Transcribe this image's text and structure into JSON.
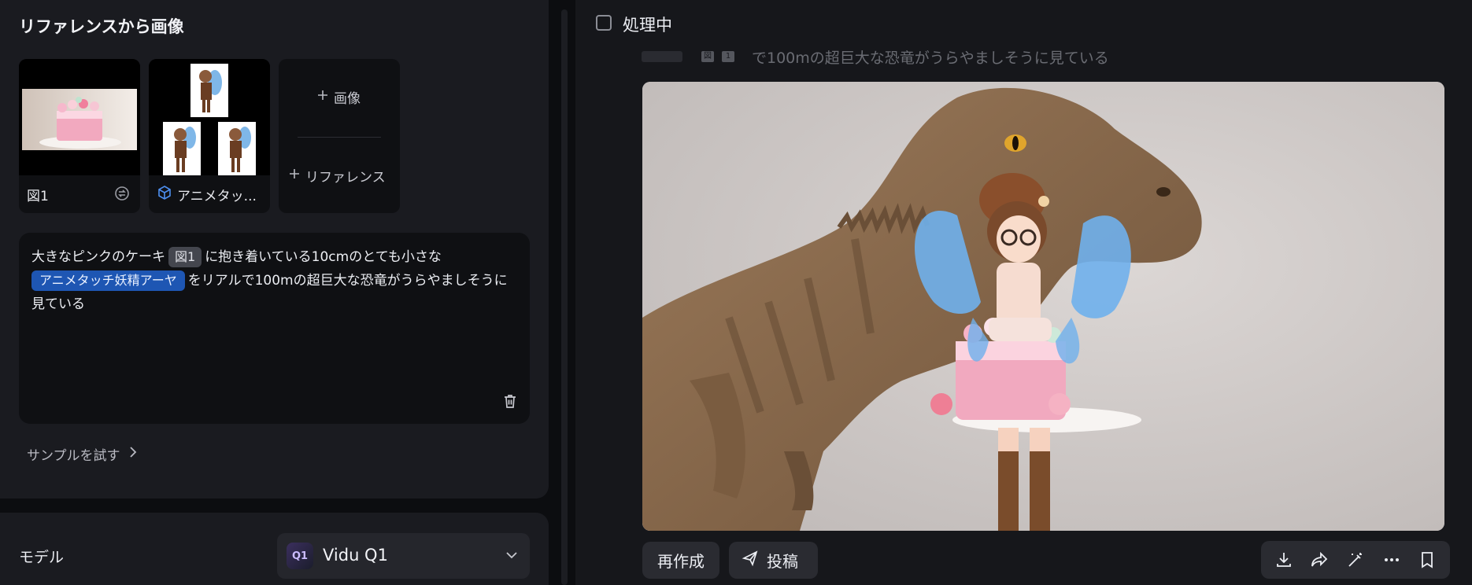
{
  "reference": {
    "title": "リファレンスから画像",
    "items": [
      {
        "label": "図1"
      },
      {
        "label": "アニメタッ..."
      }
    ],
    "add_image": "画像",
    "add_reference": "リファレンス"
  },
  "prompt": {
    "part1": "大きなピンクのケーキ",
    "chip_ref": "図1",
    "part2": "に抱き着いている10cmのとても小さな",
    "chip_char": "アニメタッチ妖精アーヤ",
    "part3": "をリアルで100mの超巨大な恐竜がうらやましそうに見ている"
  },
  "try_sample": "サンプルを試す",
  "model": {
    "label": "モデル",
    "value": "Vidu Q1",
    "logo_text": "Q1"
  },
  "result": {
    "status": "処理中",
    "prompt_preview": "で100mの超巨大な恐竜がうらやましそうに見ている",
    "preview_badges": [
      "図",
      "1"
    ],
    "regenerate": "再作成",
    "post": "投稿"
  },
  "colors": {
    "panel": "#1a1b20",
    "box": "#0f1013",
    "chip_blue": "#1e56b3",
    "button": "#2a2b31"
  }
}
